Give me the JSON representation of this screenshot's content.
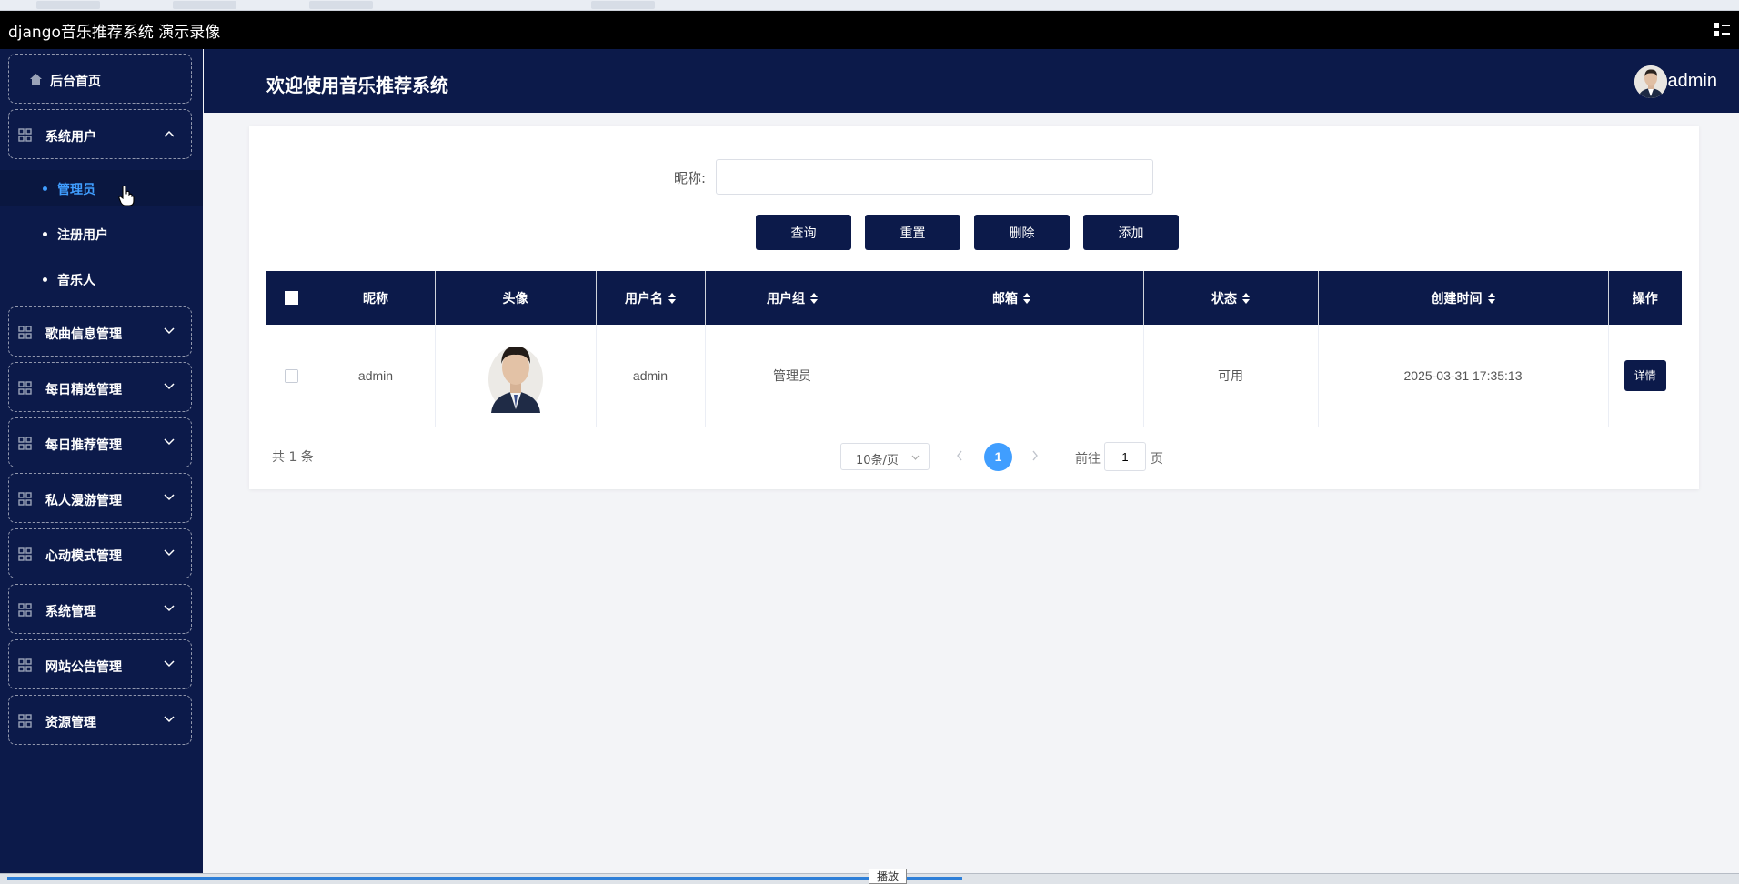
{
  "window": {
    "title": "django音乐推荐系统 演示录像"
  },
  "header": {
    "title": "欢迎使用音乐推荐系统",
    "username": "admin"
  },
  "sidebar": {
    "home": "后台首页",
    "system_users": "系统用户",
    "sub_items": [
      "管理员",
      "注册用户",
      "音乐人"
    ],
    "active_sub": "管理员",
    "groups": [
      "歌曲信息管理",
      "每日精选管理",
      "每日推荐管理",
      "私人漫游管理",
      "心动模式管理",
      "系统管理",
      "网站公告管理",
      "资源管理"
    ]
  },
  "search": {
    "label": "昵称:",
    "value": ""
  },
  "buttons": {
    "query": "查询",
    "reset": "重置",
    "delete": "删除",
    "add": "添加"
  },
  "table": {
    "columns": [
      "昵称",
      "头像",
      "用户名",
      "用户组",
      "邮箱",
      "状态",
      "创建时间",
      "操作"
    ],
    "rows": [
      {
        "nickname": "admin",
        "username": "admin",
        "group": "管理员",
        "email": "",
        "status": "可用",
        "created": "2025-03-31 17:35:13",
        "action": "详情"
      }
    ]
  },
  "pagination": {
    "total": "共 1 条",
    "page_size": "10条/页",
    "current": "1",
    "goto_label": "前往",
    "goto_value": "1",
    "goto_suffix": "页"
  },
  "player": {
    "tooltip": "播放",
    "progress": 0.55
  },
  "colors": {
    "sidebar_bg": "#0c1a4a",
    "accent": "#409eff"
  }
}
